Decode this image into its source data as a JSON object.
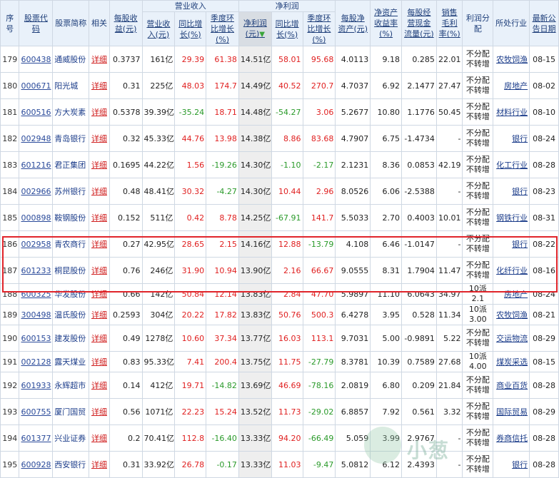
{
  "headers": {
    "seq": "序号",
    "code": "股票代码",
    "name": "股票简称",
    "related": "相关",
    "eps": "每股收益(元)",
    "revenue_group": "营业收入",
    "rev": "营业收入(元)",
    "rev_yoy": "同比增长(%)",
    "rev_qoq": "季度环比增长(%)",
    "profit_group": "净利润",
    "profit": "净利润(元)",
    "profit_yoy": "同比增长(%)",
    "profit_qoq": "季度环比增长(%)",
    "bvps": "每股净资产(元)",
    "roe": "净资产收益率(%)",
    "cfps": "每股经营现金流量(元)",
    "margin": "销售毛利率(%)",
    "dist": "利润分配",
    "industry": "所处行业",
    "date": "最新公告日期"
  },
  "rows": [
    {
      "seq": "179",
      "code": "600438",
      "name": "通威股份",
      "detail": "详细",
      "eps": "0.3737",
      "rev": "161亿",
      "rev_yoy": "29.39",
      "rev_qoq": "61.38",
      "profit": "14.51亿",
      "p_yoy": "58.01",
      "p_qoq": "95.68",
      "bvps": "4.0113",
      "roe": "9.18",
      "cfps": "0.285",
      "margin": "22.01",
      "dist": "不分配不转增",
      "industry": "农牧饲渔",
      "date": "08-15",
      "rev_yoy_dir": "up",
      "rev_qoq_dir": "up",
      "p_yoy_dir": "up",
      "p_qoq_dir": "up"
    },
    {
      "seq": "180",
      "code": "000671",
      "name": "阳光城",
      "detail": "详细",
      "eps": "0.31",
      "rev": "225亿",
      "rev_yoy": "48.03",
      "rev_qoq": "174.7",
      "profit": "14.49亿",
      "p_yoy": "40.52",
      "p_qoq": "270.7",
      "bvps": "4.7037",
      "roe": "6.92",
      "cfps": "2.1477",
      "margin": "27.47",
      "dist": "不分配不转增",
      "industry": "房地产",
      "date": "08-02",
      "rev_yoy_dir": "up",
      "rev_qoq_dir": "up",
      "p_yoy_dir": "up",
      "p_qoq_dir": "up"
    },
    {
      "seq": "181",
      "code": "600516",
      "name": "方大炭素",
      "detail": "详细",
      "eps": "0.5378",
      "rev": "39.39亿",
      "rev_yoy": "-35.24",
      "rev_qoq": "18.71",
      "profit": "14.48亿",
      "p_yoy": "-54.27",
      "p_qoq": "3.06",
      "bvps": "5.2677",
      "roe": "10.80",
      "cfps": "1.1776",
      "margin": "50.45",
      "dist": "不分配不转增",
      "industry": "材料行业",
      "date": "08-10",
      "rev_yoy_dir": "down",
      "rev_qoq_dir": "up",
      "p_yoy_dir": "down",
      "p_qoq_dir": "up"
    },
    {
      "seq": "182",
      "code": "002948",
      "name": "青岛银行",
      "detail": "详细",
      "eps": "0.32",
      "rev": "45.33亿",
      "rev_yoy": "44.76",
      "rev_qoq": "13.98",
      "profit": "14.38亿",
      "p_yoy": "8.86",
      "p_qoq": "83.68",
      "bvps": "4.7907",
      "roe": "6.75",
      "cfps": "-1.4734",
      "margin": "-",
      "dist": "不分配不转增",
      "industry": "银行",
      "date": "08-24",
      "rev_yoy_dir": "up",
      "rev_qoq_dir": "up",
      "p_yoy_dir": "up",
      "p_qoq_dir": "up"
    },
    {
      "seq": "183",
      "code": "601216",
      "name": "君正集团",
      "detail": "详细",
      "eps": "0.1695",
      "rev": "44.22亿",
      "rev_yoy": "1.56",
      "rev_qoq": "-19.26",
      "profit": "14.30亿",
      "p_yoy": "-1.10",
      "p_qoq": "-2.17",
      "bvps": "2.1231",
      "roe": "8.36",
      "cfps": "0.0853",
      "margin": "42.19",
      "dist": "不分配不转增",
      "industry": "化工行业",
      "date": "08-28",
      "rev_yoy_dir": "up",
      "rev_qoq_dir": "down",
      "p_yoy_dir": "down",
      "p_qoq_dir": "down"
    },
    {
      "seq": "184",
      "code": "002966",
      "name": "苏州银行",
      "detail": "详细",
      "eps": "0.48",
      "rev": "48.41亿",
      "rev_yoy": "30.32",
      "rev_qoq": "-4.27",
      "profit": "14.30亿",
      "p_yoy": "10.44",
      "p_qoq": "2.96",
      "bvps": "8.0526",
      "roe": "6.06",
      "cfps": "-2.5388",
      "margin": "-",
      "dist": "不分配不转增",
      "industry": "银行",
      "date": "08-23",
      "rev_yoy_dir": "up",
      "rev_qoq_dir": "down",
      "p_yoy_dir": "up",
      "p_qoq_dir": "up"
    },
    {
      "seq": "185",
      "code": "000898",
      "name": "鞍钢股份",
      "detail": "详细",
      "eps": "0.152",
      "rev": "511亿",
      "rev_yoy": "0.42",
      "rev_qoq": "8.78",
      "profit": "14.25亿",
      "p_yoy": "-67.91",
      "p_qoq": "141.7",
      "bvps": "5.5033",
      "roe": "2.70",
      "cfps": "0.4003",
      "margin": "10.01",
      "dist": "不分配不转增",
      "industry": "钢铁行业",
      "date": "08-31",
      "rev_yoy_dir": "up",
      "rev_qoq_dir": "up",
      "p_yoy_dir": "down",
      "p_qoq_dir": "up"
    },
    {
      "seq": "186",
      "code": "002958",
      "name": "青农商行",
      "detail": "详细",
      "eps": "0.27",
      "rev": "42.95亿",
      "rev_yoy": "28.65",
      "rev_qoq": "2.15",
      "profit": "14.16亿",
      "p_yoy": "12.88",
      "p_qoq": "-13.79",
      "bvps": "4.108",
      "roe": "6.46",
      "cfps": "-1.0147",
      "margin": "-",
      "dist": "不分配不转增",
      "industry": "银行",
      "date": "08-22",
      "rev_yoy_dir": "up",
      "rev_qoq_dir": "up",
      "p_yoy_dir": "up",
      "p_qoq_dir": "down"
    },
    {
      "seq": "187",
      "code": "601233",
      "name": "桐昆股份",
      "detail": "详细",
      "eps": "0.76",
      "rev": "246亿",
      "rev_yoy": "31.90",
      "rev_qoq": "10.94",
      "profit": "13.90亿",
      "p_yoy": "2.16",
      "p_qoq": "66.67",
      "bvps": "9.0555",
      "roe": "8.31",
      "cfps": "1.7904",
      "margin": "11.47",
      "dist": "不分配不转增",
      "industry": "化纤行业",
      "date": "08-16",
      "rev_yoy_dir": "up",
      "rev_qoq_dir": "up",
      "p_yoy_dir": "up",
      "p_qoq_dir": "up"
    },
    {
      "seq": "188",
      "code": "600325",
      "name": "华发股份",
      "detail": "详细",
      "eps": "0.66",
      "rev": "142亿",
      "rev_yoy": "50.84",
      "rev_qoq": "12.14",
      "profit": "13.83亿",
      "p_yoy": "2.84",
      "p_qoq": "47.70",
      "bvps": "5.9897",
      "roe": "11.10",
      "cfps": "6.0643",
      "margin": "34.97",
      "dist": "10派2.1",
      "industry": "房地产",
      "date": "08-24",
      "rev_yoy_dir": "up",
      "rev_qoq_dir": "up",
      "p_yoy_dir": "up",
      "p_qoq_dir": "up",
      "short": true
    },
    {
      "seq": "189",
      "code": "300498",
      "name": "温氏股份",
      "detail": "详细",
      "eps": "0.2593",
      "rev": "304亿",
      "rev_yoy": "20.22",
      "rev_qoq": "17.82",
      "profit": "13.83亿",
      "p_yoy": "50.76",
      "p_qoq": "500.3",
      "bvps": "6.4278",
      "roe": "3.95",
      "cfps": "0.528",
      "margin": "11.34",
      "dist": "10派3.00",
      "industry": "农牧饲渔",
      "date": "08-21",
      "rev_yoy_dir": "up",
      "rev_qoq_dir": "up",
      "p_yoy_dir": "up",
      "p_qoq_dir": "up",
      "short": true
    },
    {
      "seq": "190",
      "code": "600153",
      "name": "建发股份",
      "detail": "详细",
      "eps": "0.49",
      "rev": "1278亿",
      "rev_yoy": "10.60",
      "rev_qoq": "37.34",
      "profit": "13.77亿",
      "p_yoy": "16.03",
      "p_qoq": "113.1",
      "bvps": "9.7031",
      "roe": "5.00",
      "cfps": "-0.9891",
      "margin": "5.22",
      "dist": "不分配不转增",
      "industry": "交运物流",
      "date": "08-29",
      "rev_yoy_dir": "up",
      "rev_qoq_dir": "up",
      "p_yoy_dir": "up",
      "p_qoq_dir": "up"
    },
    {
      "seq": "191",
      "code": "002128",
      "name": "露天煤业",
      "detail": "详细",
      "eps": "0.83",
      "rev": "95.33亿",
      "rev_yoy": "7.41",
      "rev_qoq": "200.4",
      "profit": "13.75亿",
      "p_yoy": "11.75",
      "p_qoq": "-27.79",
      "bvps": "8.3781",
      "roe": "10.39",
      "cfps": "0.7589",
      "margin": "27.68",
      "dist": "10派4.00",
      "industry": "煤炭采选",
      "date": "08-15",
      "rev_yoy_dir": "up",
      "rev_qoq_dir": "up",
      "p_yoy_dir": "up",
      "p_qoq_dir": "down",
      "short": true
    },
    {
      "seq": "192",
      "code": "601933",
      "name": "永辉超市",
      "detail": "详细",
      "eps": "0.14",
      "rev": "412亿",
      "rev_yoy": "19.71",
      "rev_qoq": "-14.82",
      "profit": "13.69亿",
      "p_yoy": "46.69",
      "p_qoq": "-78.16",
      "bvps": "2.0819",
      "roe": "6.80",
      "cfps": "0.209",
      "margin": "21.84",
      "dist": "不分配不转增",
      "industry": "商业百货",
      "date": "08-28",
      "rev_yoy_dir": "up",
      "rev_qoq_dir": "down",
      "p_yoy_dir": "up",
      "p_qoq_dir": "down"
    },
    {
      "seq": "193",
      "code": "600755",
      "name": "厦门国贸",
      "detail": "详细",
      "eps": "0.56",
      "rev": "1071亿",
      "rev_yoy": "22.23",
      "rev_qoq": "15.24",
      "profit": "13.52亿",
      "p_yoy": "11.73",
      "p_qoq": "-29.02",
      "bvps": "6.8857",
      "roe": "7.92",
      "cfps": "0.561",
      "margin": "3.32",
      "dist": "不分配不转增",
      "industry": "国际贸易",
      "date": "08-29",
      "rev_yoy_dir": "up",
      "rev_qoq_dir": "up",
      "p_yoy_dir": "up",
      "p_qoq_dir": "down"
    },
    {
      "seq": "194",
      "code": "601377",
      "name": "兴业证券",
      "detail": "详细",
      "eps": "0.2",
      "rev": "70.41亿",
      "rev_yoy": "112.8",
      "rev_qoq": "-16.40",
      "profit": "13.33亿",
      "p_yoy": "94.20",
      "p_qoq": "-66.49",
      "bvps": "5.059",
      "roe": "3.99",
      "cfps": "2.9767",
      "margin": "-",
      "dist": "不分配不转增",
      "industry": "券商信托",
      "date": "08-28",
      "rev_yoy_dir": "up",
      "rev_qoq_dir": "down",
      "p_yoy_dir": "up",
      "p_qoq_dir": "down"
    },
    {
      "seq": "195",
      "code": "600928",
      "name": "西安银行",
      "detail": "详细",
      "eps": "0.31",
      "rev": "33.92亿",
      "rev_yoy": "26.78",
      "rev_qoq": "-0.17",
      "profit": "13.33亿",
      "p_yoy": "11.03",
      "p_qoq": "-9.47",
      "bvps": "5.0812",
      "roe": "6.12",
      "cfps": "2.4393",
      "margin": "-",
      "dist": "不分配不转增",
      "industry": "银行",
      "date": "08-28",
      "rev_yoy_dir": "up",
      "rev_qoq_dir": "down",
      "p_yoy_dir": "up",
      "p_qoq_dir": "down"
    }
  ],
  "watermark": "小葱"
}
